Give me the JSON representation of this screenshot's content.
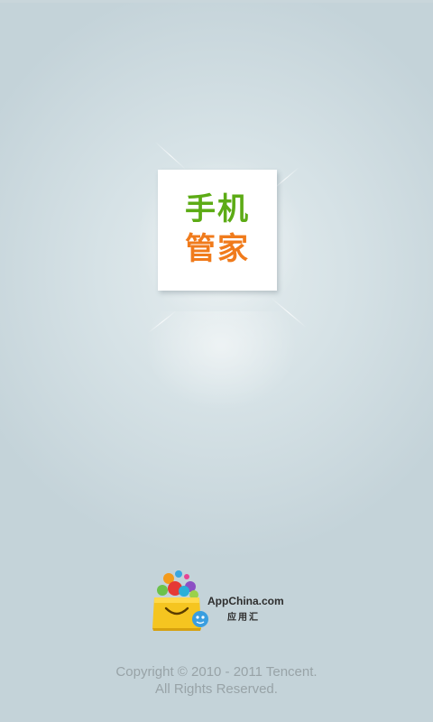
{
  "splash": {
    "logo": {
      "line1": "手机",
      "line2": "管家",
      "colors": {
        "line1": "#5cab15",
        "line2": "#f07b1c"
      }
    },
    "partner": {
      "name": "AppChina.com",
      "sub": "应用汇",
      "icon": "shopping-bag-icon"
    },
    "copyright": {
      "line1": "Copyright © 2010 - 2011 Tencent.",
      "line2": "All Rights Reserved."
    },
    "colors": {
      "background": "#d6e2e6",
      "copyright_text": "#98a3a7"
    }
  }
}
